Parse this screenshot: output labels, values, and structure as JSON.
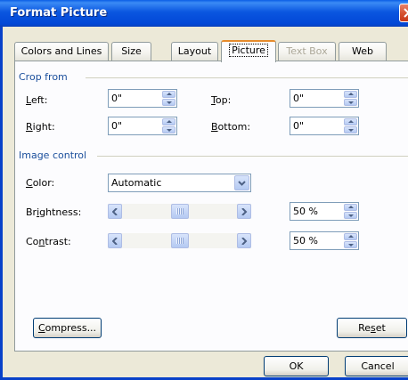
{
  "window": {
    "title": "Format Picture"
  },
  "tabs": [
    {
      "label": "Colors and Lines",
      "state": "normal"
    },
    {
      "label": "Size",
      "state": "normal"
    },
    {
      "label": "Layout",
      "state": "normal"
    },
    {
      "label": "Picture",
      "state": "active"
    },
    {
      "label": "Text Box",
      "state": "disabled"
    },
    {
      "label": "Web",
      "state": "normal"
    }
  ],
  "crop": {
    "group_label": "Crop from",
    "left": {
      "label": "Left:",
      "value": "0\""
    },
    "right": {
      "label": "Right:",
      "value": "0\""
    },
    "top": {
      "label": "Top:",
      "value": "0\""
    },
    "bottom": {
      "label": "Bottom:",
      "value": "0\""
    }
  },
  "image_control": {
    "group_label": "Image control",
    "color": {
      "label": "Color:",
      "value": "Automatic"
    },
    "brightness": {
      "label": "Brightness:",
      "value": "50 %",
      "level": 0.5
    },
    "contrast": {
      "label": "Contrast:",
      "value": "50 %",
      "level": 0.5
    }
  },
  "buttons": {
    "compress": "Compress...",
    "reset": "Reset",
    "ok": "OK",
    "cancel": "Cancel"
  },
  "colors": {
    "title_bar": "#0a56e0",
    "group_label": "#1b4f9c",
    "active_tab_accent": "#e68b2c",
    "close_button": "#d5512f"
  }
}
